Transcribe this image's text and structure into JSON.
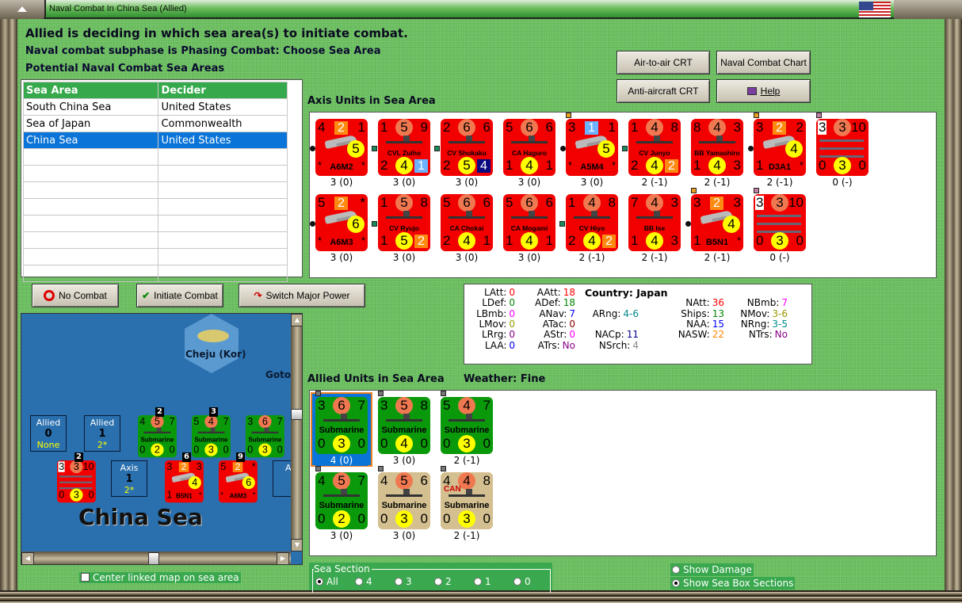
{
  "window": {
    "title": "Naval Combat In China Sea (Allied)"
  },
  "header": {
    "line1": "Allied is deciding in which sea area(s) to initiate combat.",
    "line2": "Naval combat subphase is Phasing Combat: Choose Sea Area",
    "line3": "Potential Naval Combat Sea Areas"
  },
  "sea_table": {
    "columns": [
      "Sea Area",
      "Decider"
    ],
    "rows": [
      [
        "South China Sea",
        "United States"
      ],
      [
        "Sea of Japan",
        "Commonwealth"
      ],
      [
        "China Sea",
        "United States"
      ]
    ],
    "selected": 2
  },
  "buttons": {
    "air_crt": "Air-to-air CRT",
    "naval_chart": "Naval Combat Chart",
    "aa_crt": "Anti-aircraft CRT",
    "help": "Help",
    "no_combat": "No Combat",
    "initiate": "Initiate Combat",
    "switch": "Switch Major Power"
  },
  "axis_label": "Axis Units in Sea Area",
  "allied_label": "Allied Units in Sea Area",
  "weather": "Weather:  Fine",
  "colors": {
    "axis": "#f20000",
    "allied": "#0a990a",
    "allied_cw": "#d3bf8f",
    "circle_orange": "#f07850",
    "circle_yellow": "#ffff00",
    "sq_orange": "#ff8a10",
    "sq_blue": "#6cb2ff",
    "sq_navy": "#0a0a80"
  },
  "axis_units": [
    {
      "kind": "air",
      "name": "A6M2",
      "t": [
        "4",
        "2",
        "1"
      ],
      "b": [
        "*",
        "*"
      ],
      "circle": "5",
      "tsq": "orange",
      "status": "3 (0)",
      "left": "dot"
    },
    {
      "kind": "ship",
      "name": "CVL Zuiho",
      "t": [
        "1",
        "5",
        "9"
      ],
      "b": [
        "2",
        "4",
        "1"
      ],
      "bsq": "blue",
      "status": "3 (0)",
      "left": "sdot"
    },
    {
      "kind": "ship",
      "name": "CV Shokaku",
      "t": [
        "2",
        "6",
        "6"
      ],
      "b": [
        "2",
        "5",
        "4"
      ],
      "bsq": "navy",
      "status": "3 (0)",
      "left": "sdot"
    },
    {
      "kind": "ship",
      "name": "CA Haguro",
      "t": [
        "5",
        "6",
        "6"
      ],
      "b": [
        "1",
        "4",
        "1"
      ],
      "status": "3 (0)"
    },
    {
      "kind": "air",
      "name": "A5M4",
      "t": [
        "3",
        "1",
        "1"
      ],
      "b": [
        "*",
        "*"
      ],
      "circle": "5",
      "tsq": "blue",
      "status": "3 (0)",
      "left": "dot",
      "mark": "#e8a020"
    },
    {
      "kind": "ship",
      "name": "CV Junyo",
      "t": [
        "1",
        "4",
        "8"
      ],
      "b": [
        "2",
        "4",
        "2"
      ],
      "bsq": "orange",
      "status": "2 (-1)",
      "left": "sdot"
    },
    {
      "kind": "ship",
      "name": "BB Yamashiro",
      "t": [
        "8",
        "4",
        "3"
      ],
      "b": [
        "1",
        "4",
        "3"
      ],
      "status": "2 (-1)"
    },
    {
      "kind": "air",
      "name": "D3A1",
      "t": [
        "3",
        "2",
        "2"
      ],
      "b": [
        "1",
        "*"
      ],
      "circle": "4",
      "tsq": "orange",
      "status": "2 (-1)",
      "left": "dot",
      "mark": "#e8a020"
    },
    {
      "kind": "convoy",
      "name": "",
      "t": [
        "3",
        "3",
        "10"
      ],
      "b": [
        "0",
        "3",
        "0"
      ],
      "status": "0 (-)",
      "mark": "#c080a0"
    },
    {
      "kind": "air",
      "name": "A6M3",
      "t": [
        "5",
        "2",
        "*"
      ],
      "b": [
        "*",
        "*"
      ],
      "circle": "6",
      "tsq": "orange",
      "status": "3 (0)",
      "left": "dot"
    },
    {
      "kind": "ship",
      "name": "CV Ryujo",
      "t": [
        "1",
        "5",
        "8"
      ],
      "b": [
        "1",
        "5",
        "2"
      ],
      "bsq": "orange",
      "status": "3 (0)",
      "left": "sdot"
    },
    {
      "kind": "ship",
      "name": "CA Chokai",
      "t": [
        "5",
        "6",
        "6"
      ],
      "b": [
        "2",
        "4",
        "1"
      ],
      "status": "3 (0)"
    },
    {
      "kind": "ship",
      "name": "CA Mogami",
      "t": [
        "5",
        "6",
        "6"
      ],
      "b": [
        "1",
        "4",
        "1"
      ],
      "status": "3 (0)"
    },
    {
      "kind": "ship",
      "name": "CV Hiyo",
      "t": [
        "1",
        "4",
        "8"
      ],
      "b": [
        "2",
        "4",
        "2"
      ],
      "bsq": "orange",
      "status": "2 (-1)",
      "left": "sdot"
    },
    {
      "kind": "ship",
      "name": "BB Ise",
      "t": [
        "7",
        "4",
        "3"
      ],
      "b": [
        "1",
        "4",
        "3"
      ],
      "status": "2 (-1)"
    },
    {
      "kind": "air",
      "name": "B5N1",
      "t": [
        "3",
        "2",
        "3"
      ],
      "b": [
        "1",
        "*"
      ],
      "circle": "4",
      "tsq": "orange",
      "status": "2 (-1)",
      "left": "dot",
      "mark": "#e8a020"
    },
    {
      "kind": "convoy",
      "name": "",
      "t": [
        "3",
        "3",
        "10"
      ],
      "b": [
        "0",
        "3",
        "0"
      ],
      "status": "0 (-)",
      "mark": "#c080a0"
    }
  ],
  "allied_units": [
    {
      "kind": "sub",
      "name": "Submarine",
      "t": [
        "3",
        "6",
        "7"
      ],
      "b": [
        "0",
        "3",
        "0"
      ],
      "status": "4 (0)",
      "selected": true,
      "mark": "#777"
    },
    {
      "kind": "sub",
      "name": "Submarine",
      "t": [
        "3",
        "5",
        "8"
      ],
      "b": [
        "0",
        "4",
        "0"
      ],
      "status": "3 (0)",
      "mark": "#777"
    },
    {
      "kind": "sub",
      "name": "Submarine",
      "t": [
        "5",
        "4",
        "7"
      ],
      "b": [
        "0",
        "3",
        "0"
      ],
      "status": "2 (-1)",
      "mark": "#777"
    },
    {
      "kind": "sub",
      "name": "Submarine",
      "t": [
        "4",
        "5",
        "7"
      ],
      "b": [
        "0",
        "2",
        "0"
      ],
      "status": "3 (0)",
      "mark": "#777"
    },
    {
      "kind": "sub",
      "name": "Submarine",
      "t": [
        "4",
        "5",
        "6"
      ],
      "b": [
        "0",
        "3",
        "0"
      ],
      "status": "3 (0)",
      "cw": true,
      "mark": "#777"
    },
    {
      "kind": "sub",
      "name": "Submarine",
      "t": [
        "4",
        "4",
        "8"
      ],
      "b": [
        "0",
        "3",
        "0"
      ],
      "status": "2 (-1)",
      "cw": true,
      "nat": "CAN",
      "mark": "#777"
    }
  ],
  "stats": {
    "country_label": "Country: Japan",
    "items": [
      {
        "k": "LAtt:",
        "v": "0",
        "c": "#f00"
      },
      {
        "k": "LDef:",
        "v": "0",
        "c": "#080"
      },
      {
        "k": "LBmb:",
        "v": "0",
        "c": "#f0f"
      },
      {
        "k": "LMov:",
        "v": "0",
        "c": "#990"
      },
      {
        "k": "LRrg:",
        "v": "0",
        "c": "#808"
      },
      {
        "k": "LAA:",
        "v": "0",
        "c": "#00f"
      },
      {
        "k": "AAtt:",
        "v": "18",
        "c": "#f00"
      },
      {
        "k": "ADef:",
        "v": "18",
        "c": "#080"
      },
      {
        "k": "ANav:",
        "v": "7",
        "c": "#00f"
      },
      {
        "k": "ATac:",
        "v": "0",
        "c": "#800"
      },
      {
        "k": "AStr:",
        "v": "0",
        "c": "#f0f"
      },
      {
        "k": "ATrs:",
        "v": "No",
        "c": "#808"
      },
      {
        "k": "ARng:",
        "v": "4-6",
        "c": "#088"
      },
      {
        "k": "NACp:",
        "v": "11",
        "c": "#008"
      },
      {
        "k": "NSrch:",
        "v": "4",
        "c": "#888"
      },
      {
        "k": "NAtt:",
        "v": "36",
        "c": "#f00"
      },
      {
        "k": "Ships:",
        "v": "13",
        "c": "#080"
      },
      {
        "k": "NAA:",
        "v": "15",
        "c": "#00f"
      },
      {
        "k": "NASW:",
        "v": "22",
        "c": "#f80"
      },
      {
        "k": "NBmb:",
        "v": "7",
        "c": "#f0f"
      },
      {
        "k": "NMov:",
        "v": "3-6",
        "c": "#990"
      },
      {
        "k": "NRng:",
        "v": "3-5",
        "c": "#088"
      },
      {
        "k": "NTrs:",
        "v": "No",
        "c": "#808"
      }
    ]
  },
  "map": {
    "hex_label": "Cheju (Kor)",
    "goto": "Goto",
    "sea_name": "China Sea",
    "boxes": [
      {
        "t": "Allied",
        "n": "0",
        "s": "None"
      },
      {
        "t": "Allied",
        "n": "1",
        "s": "2*"
      },
      {
        "t": "Axis",
        "n": "1",
        "s": "2*"
      },
      {
        "t": "Ax",
        "n": "",
        "s": ""
      }
    ],
    "badges": [
      "2",
      "3",
      "2",
      "6",
      "9"
    ]
  },
  "options": {
    "center_linked": "Center linked map on sea area",
    "sea_section_label": "Sea Section",
    "sections": [
      "All",
      "4",
      "3",
      "2",
      "1",
      "0"
    ],
    "show_damage": "Show Damage",
    "show_sections": "Show Sea Box Sections"
  }
}
